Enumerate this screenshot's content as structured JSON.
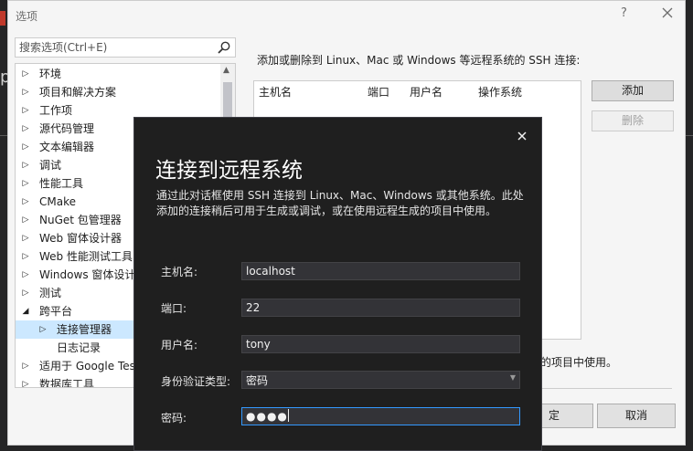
{
  "options_dialog": {
    "title": "选项",
    "help": "?",
    "search_placeholder": "搜索选项(Ctrl+E)",
    "tree_items": [
      {
        "label": "环境",
        "arrow": "▷",
        "indent": 0
      },
      {
        "label": "项目和解决方案",
        "arrow": "▷",
        "indent": 0
      },
      {
        "label": "工作项",
        "arrow": "▷",
        "indent": 0
      },
      {
        "label": "源代码管理",
        "arrow": "▷",
        "indent": 0
      },
      {
        "label": "文本编辑器",
        "arrow": "▷",
        "indent": 0
      },
      {
        "label": "调试",
        "arrow": "▷",
        "indent": 0
      },
      {
        "label": "性能工具",
        "arrow": "▷",
        "indent": 0
      },
      {
        "label": "CMake",
        "arrow": "▷",
        "indent": 0
      },
      {
        "label": "NuGet 包管理器",
        "arrow": "▷",
        "indent": 0
      },
      {
        "label": "Web 窗体设计器",
        "arrow": "▷",
        "indent": 0
      },
      {
        "label": "Web 性能测试工具",
        "arrow": "▷",
        "indent": 0
      },
      {
        "label": "Windows 窗体设计器",
        "arrow": "▷",
        "indent": 0
      },
      {
        "label": "测试",
        "arrow": "▷",
        "indent": 0
      },
      {
        "label": "跨平台",
        "arrow": "◢",
        "indent": 0
      },
      {
        "label": "连接管理器",
        "arrow": "▷",
        "indent": 1,
        "selected": true
      },
      {
        "label": "日志记录",
        "arrow": "",
        "indent": 1
      },
      {
        "label": "适用于 Google Test",
        "arrow": "▷",
        "indent": 0
      },
      {
        "label": "数据库工具",
        "arrow": "▷",
        "indent": 0
      }
    ],
    "description": "添加或删除到 Linux、Mac 或 Windows 等远程系统的 SSH 连接:",
    "table_headers": [
      "主机名",
      "端口",
      "用户名",
      "操作系统"
    ],
    "add_label": "添加",
    "delete_label": "删除",
    "note_fragment": "的项目中使用。",
    "ok_label_fragment": "定",
    "cancel_label": "取消"
  },
  "connect_dialog": {
    "title": "连接到远程系统",
    "description": "通过此对话框使用 SSH 连接到 Linux、Mac、Windows 或其他系统。此处添加的连接稍后可用于生成或调试，或在使用远程生成的项目中使用。",
    "fields": {
      "host": {
        "label": "主机名:",
        "value": "localhost"
      },
      "port": {
        "label": "端口:",
        "value": "22"
      },
      "user": {
        "label": "用户名:",
        "value": "tony"
      },
      "auth": {
        "label": "身份验证类型:",
        "value": "密码"
      },
      "password": {
        "label": "密码:",
        "value": "●●●●"
      }
    }
  },
  "background": {
    "fragment": "p"
  },
  "colors": {
    "accent": "#3399ff",
    "dialog_bg": "#1f1f1f",
    "selected_bg": "#cce8ff"
  }
}
